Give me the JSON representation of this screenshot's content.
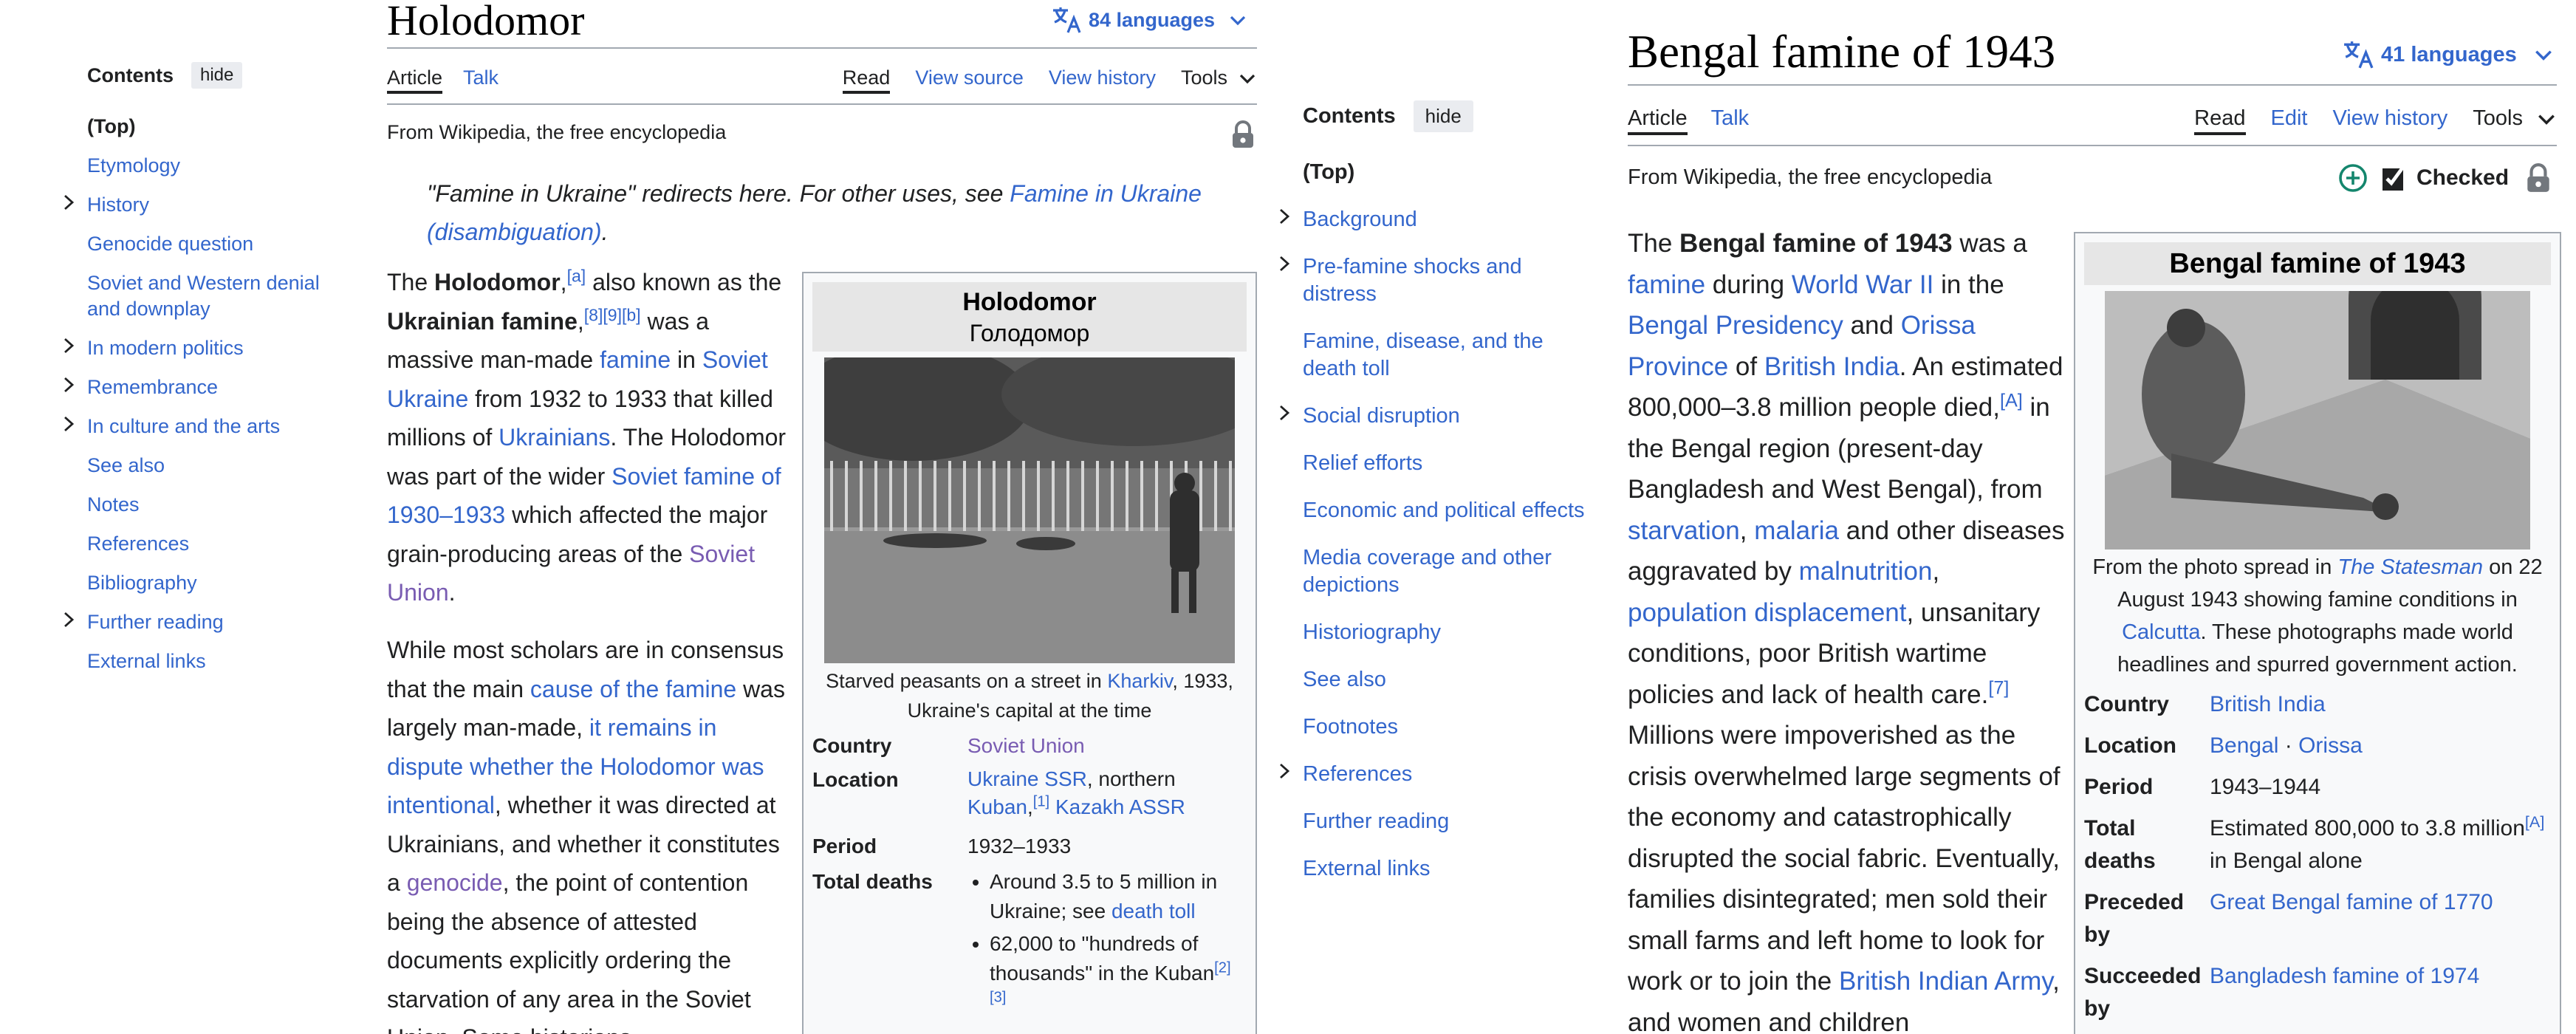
{
  "left": {
    "toc": {
      "title": "Contents",
      "hide_label": "hide",
      "items": [
        {
          "label": "(Top)",
          "top": true
        },
        {
          "label": "Etymology"
        },
        {
          "label": "History",
          "expandable": true
        },
        {
          "label": "Genocide question"
        },
        {
          "label": "Soviet and Western denial and downplay"
        },
        {
          "label": "In modern politics",
          "expandable": true
        },
        {
          "label": "Remembrance",
          "expandable": true
        },
        {
          "label": "In culture and the arts",
          "expandable": true
        },
        {
          "label": "See also"
        },
        {
          "label": "Notes"
        },
        {
          "label": "References"
        },
        {
          "label": "Bibliography"
        },
        {
          "label": "Further reading",
          "expandable": true
        },
        {
          "label": "External links"
        }
      ]
    },
    "article": {
      "title": "Holodomor",
      "languages": "84 languages",
      "tabs": {
        "article": "Article",
        "talk": "Talk",
        "read": "Read",
        "view_source": "View source",
        "view_history": "View history",
        "tools": "Tools"
      },
      "tagline": "From Wikipedia, the free encyclopedia",
      "hatnote": {
        "prefix": "\"Famine in Ukraine\" redirects here. For other uses, see ",
        "link": "Famine in Ukraine (disambiguation)",
        "suffix": "."
      },
      "p1": {
        "t1": "The ",
        "b1": "Holodomor",
        "t2": ",",
        "s1": "[a]",
        "t3": " also known as the ",
        "b2": "Ukrainian famine",
        "t4": ",",
        "s2": "[8][9][b]",
        "t5": " was a massive man-made ",
        "l1": "famine",
        "t6": " in ",
        "l2": "Soviet Ukraine",
        "t7": " from 1932 to 1933 that killed millions of ",
        "l3": "Ukrainians",
        "t8": ". The Holodomor was part of the wider ",
        "l4": "Soviet famine of 1930–1933",
        "t9": " which affected the major grain-producing areas of the ",
        "l5": "Soviet Union",
        "t10": "."
      },
      "p2": {
        "t1": "While most scholars are in consensus that the main ",
        "l1": "cause of the famine",
        "t2": " was largely man-made, ",
        "l2": "it remains in dispute whether the Holodomor was intentional",
        "t3": ", whether it was directed at Ukrainians, and whether it constitutes a ",
        "l3": "genocide",
        "t4": ", the point of contention being the absence of attested documents explicitly ordering the starvation of any area in the Soviet Union. Some historians"
      },
      "infobox": {
        "title": "Holodomor",
        "subtitle": "Голодомор",
        "caption_prefix": "Starved peasants on a street in ",
        "caption_link": "Kharkiv",
        "caption_suffix": ", 1933, Ukraine's capital at the time",
        "country_label": "Country",
        "country_value": "Soviet Union",
        "location_label": "Location",
        "location_l1": "Ukraine SSR",
        "location_t1": ", northern ",
        "location_l2": "Kuban",
        "location_s1": "[1]",
        "location_l3": "Kazakh ASSR",
        "period_label": "Period",
        "period_value": "1932–1933",
        "deaths_label": "Total deaths",
        "deaths_1_text": "Around 3.5 to 5 million in Ukraine; see ",
        "deaths_1_link": "death toll",
        "deaths_2_text": "62,000 to \"hundreds of thousands\" in the Kuban",
        "deaths_2_sup": "[2]",
        "deaths_2_sup2": "[3]"
      }
    }
  },
  "right": {
    "toc": {
      "title": "Contents",
      "hide_label": "hide",
      "items": [
        {
          "label": "(Top)",
          "top": true
        },
        {
          "label": "Background",
          "expandable": true
        },
        {
          "label": "Pre-famine shocks and distress",
          "expandable": true
        },
        {
          "label": "Famine, disease, and the death toll"
        },
        {
          "label": "Social disruption",
          "expandable": true
        },
        {
          "label": "Relief efforts"
        },
        {
          "label": "Economic and political effects"
        },
        {
          "label": "Media coverage and other depictions"
        },
        {
          "label": "Historiography"
        },
        {
          "label": "See also"
        },
        {
          "label": "Footnotes"
        },
        {
          "label": "References",
          "expandable": true
        },
        {
          "label": "Further reading"
        },
        {
          "label": "External links"
        }
      ]
    },
    "article": {
      "title": "Bengal famine of 1943",
      "languages": "41 languages",
      "tabs": {
        "article": "Article",
        "talk": "Talk",
        "read": "Read",
        "edit": "Edit",
        "view_history": "View history",
        "tools": "Tools"
      },
      "tagline": "From Wikipedia, the free encyclopedia",
      "checked_label": "Checked",
      "p1": {
        "t1": "The ",
        "b1": "Bengal famine of 1943",
        "t2": " was a ",
        "l1": "famine",
        "t3": " during ",
        "l2": "World War II",
        "t4": " in the ",
        "l3": "Bengal Presidency",
        "t5": " and ",
        "l4": "Orissa Province",
        "t6": " of ",
        "l5": "British India",
        "t7": ". An estimated 800,000–3.8 million people died,",
        "s1": "[A]",
        "t8": " in the Bengal region (present-day Bangladesh and West Bengal), from ",
        "l6": "starvation",
        "t9": ", ",
        "l7": "malaria",
        "t10": " and other diseases aggravated by ",
        "l8": "malnutrition",
        "t11": ", ",
        "l9": "population displacement",
        "t12": ", unsanitary conditions, poor British wartime policies and lack of health care.",
        "s2": "[7]",
        "t13": " Millions were impoverished as the crisis overwhelmed large segments of the economy and catastrophically disrupted the social fabric. Eventually, families disintegrated; men sold their small farms and left home to look for work or to join the ",
        "l10": "British Indian Army",
        "t14": ", and women and children"
      },
      "infobox": {
        "title": "Bengal famine of 1943",
        "caption_prefix": "From the photo spread in ",
        "caption_link": "The Statesman",
        "caption_mid": " on 22 August 1943 showing famine conditions in ",
        "caption_link2": "Calcutta",
        "caption_suffix": ". These photographs made world headlines and spurred government action.",
        "country_label": "Country",
        "country_value": "British India",
        "location_label": "Location",
        "location_l1": "Bengal",
        "location_sep": " · ",
        "location_l2": "Orissa",
        "period_label": "Period",
        "period_value": "1943–1944",
        "deaths_label": "Total deaths",
        "deaths_value": "Estimated 800,000 to 3.8 million",
        "deaths_sup": "[A]",
        "deaths_value2": " in Bengal alone",
        "preceded_label": "Preceded by",
        "preceded_value": "Great Bengal famine of 1770",
        "succeeded_label": "Succeeded by",
        "succeeded_value": "Bangladesh famine of 1974"
      }
    }
  },
  "colors": {
    "link": "#3366cc",
    "visited": "#795cb2",
    "text": "#202122",
    "border": "#a2a9b1",
    "infobox_bg": "#f8f9fa",
    "checked_green": "#14866d"
  },
  "icons": [
    "translate-icon",
    "chevron-down-icon",
    "chevron-right-icon",
    "lock-icon",
    "add-circle-icon",
    "checkbox-icon"
  ]
}
